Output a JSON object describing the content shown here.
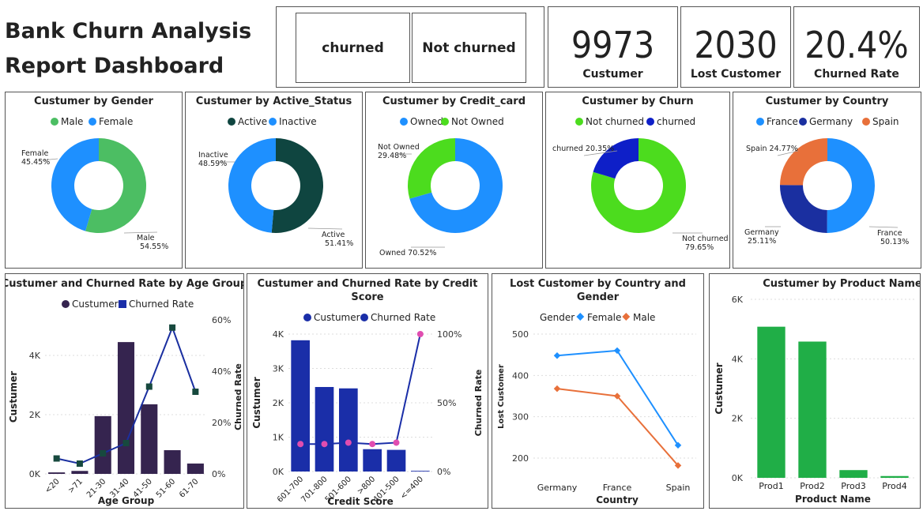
{
  "header": {
    "title_line1": "Bank Churn Analysis",
    "title_line2": "Report Dashboard"
  },
  "slicer": {
    "options": [
      "churned",
      "Not churned"
    ]
  },
  "kpis": [
    {
      "value": "9973",
      "label": "Custumer"
    },
    {
      "value": "2030",
      "label": "Lost Customer"
    },
    {
      "value": "20.4%",
      "label": "Churned Rate"
    }
  ],
  "colors": {
    "green": "#4CBE63",
    "blue": "#1E90FF",
    "darkteal": "#0F4540",
    "lime": "#4CDC1E",
    "navy": "#0E1FC8",
    "orange": "#E8703A",
    "darkblue": "#1A2FA0",
    "purple": "#35244F",
    "barblue": "#1A2EA8",
    "pink": "#E04DB0",
    "barGreen": "#20AE47"
  },
  "chart_data": [
    {
      "type": "pie",
      "title": "Custumer by Gender",
      "legend": [
        "Male",
        "Female"
      ],
      "slices": [
        {
          "name": "Male",
          "value": 54.55,
          "label": "Male",
          "pct": "54.55%",
          "color": "#4CBE63"
        },
        {
          "name": "Female",
          "value": 45.45,
          "label": "Female",
          "pct": "45.45%",
          "color": "#1E90FF"
        }
      ]
    },
    {
      "type": "pie",
      "title": "Custumer by Active_Status",
      "legend": [
        "Active",
        "Inactive"
      ],
      "slices": [
        {
          "name": "Active",
          "value": 51.41,
          "label": "Active",
          "pct": "51.41%",
          "color": "#0F4540"
        },
        {
          "name": "Inactive",
          "value": 48.59,
          "label": "Inactive",
          "pct": "48.59%",
          "color": "#1E90FF"
        }
      ]
    },
    {
      "type": "pie",
      "title": "Custumer by Credit_card",
      "legend": [
        "Owned",
        "Not Owned"
      ],
      "slices": [
        {
          "name": "Owned",
          "value": 70.52,
          "label": "Owned 70.52%",
          "pct": "",
          "color": "#1E90FF"
        },
        {
          "name": "Not Owned",
          "value": 29.48,
          "label": "Not Owned",
          "pct": "29.48%",
          "color": "#4CDC1E"
        }
      ]
    },
    {
      "type": "pie",
      "title": "Custumer by Churn",
      "legend": [
        "Not churned",
        "churned"
      ],
      "slices": [
        {
          "name": "Not churned",
          "value": 79.65,
          "label": "Not churned",
          "pct": "79.65%",
          "color": "#4CDC1E"
        },
        {
          "name": "churned",
          "value": 20.35,
          "label": "churned 20.35%",
          "pct": "",
          "color": "#0E1FC8"
        }
      ]
    },
    {
      "type": "pie",
      "title": "Custumer by Country",
      "legend": [
        "France",
        "Germany",
        "Spain"
      ],
      "slices": [
        {
          "name": "France",
          "value": 50.13,
          "label": "France",
          "pct": "50.13%",
          "color": "#1E90FF"
        },
        {
          "name": "Germany",
          "value": 25.11,
          "label": "Germany",
          "pct": "25.11%",
          "color": "#1A2FA0"
        },
        {
          "name": "Spain",
          "value": 24.77,
          "label": "Spain 24.77%",
          "pct": "",
          "color": "#E8703A"
        }
      ]
    },
    {
      "type": "bar",
      "title": "Custumer and Churned Rate by Age Group",
      "legend": [
        "Custumer",
        "Churned Rate"
      ],
      "categories": [
        "<20",
        ">71",
        "21-30",
        "31-40",
        "41-50",
        "51-60",
        "61-70"
      ],
      "series": [
        {
          "name": "Custumer",
          "values": [
            50,
            100,
            1950,
            4450,
            2350,
            800,
            350
          ]
        },
        {
          "name": "Churned Rate",
          "values": [
            6,
            4,
            8,
            12,
            34,
            57,
            32
          ]
        }
      ],
      "xlabel": "Age Group",
      "ylabel": "Custumer",
      "y2label": "Churned Rate",
      "yticks": [
        "0K",
        "2K",
        "4K"
      ],
      "y2ticks": [
        "0%",
        "20%",
        "40%",
        "60%"
      ],
      "ylim": [
        0,
        5200
      ],
      "y2lim": [
        0,
        60
      ]
    },
    {
      "type": "bar",
      "title_line1": "Custumer and Churned Rate by Credit",
      "title_line2": "Score",
      "legend": [
        "Custumer",
        "Churned Rate"
      ],
      "categories": [
        "601-700",
        "701-800",
        "501-600",
        ">800",
        "401-500",
        "<=400"
      ],
      "series": [
        {
          "name": "Custumer",
          "values": [
            3820,
            2460,
            2420,
            650,
            630,
            20
          ]
        },
        {
          "name": "Churned Rate",
          "values": [
            20,
            20,
            21,
            20,
            21,
            100
          ]
        }
      ],
      "xlabel": "Credit Score",
      "ylabel": "Custumer",
      "y2label": "Churned Rate",
      "yticks": [
        "0K",
        "1K",
        "2K",
        "3K",
        "4K"
      ],
      "y2ticks": [
        "0%",
        "50%",
        "100%"
      ],
      "ylim": [
        0,
        4000
      ],
      "y2lim": [
        0,
        100
      ]
    },
    {
      "type": "line",
      "title_line1": "Lost Customer by Country and",
      "title_line2": "Gender",
      "legend_title": "Gender",
      "legend": [
        "Female",
        "Male"
      ],
      "categories": [
        "Germany",
        "France",
        "Spain"
      ],
      "series": [
        {
          "name": "Female",
          "values": [
            448,
            460,
            231
          ]
        },
        {
          "name": "Male",
          "values": [
            368,
            350,
            182
          ]
        }
      ],
      "xlabel": "Country",
      "ylabel": "Lost Customer",
      "yticks": [
        "200",
        "300",
        "400",
        "500"
      ],
      "ylim": [
        200,
        500
      ]
    },
    {
      "type": "bar",
      "title": "Custumer by Product Name",
      "categories": [
        "Prod1",
        "Prod2",
        "Prod3",
        "Prod4"
      ],
      "series": [
        {
          "name": "Custumer",
          "values": [
            5080,
            4580,
            260,
            60
          ]
        }
      ],
      "xlabel": "Product Name",
      "ylabel": "Custumer",
      "yticks": [
        "0K",
        "2K",
        "4K",
        "6K"
      ],
      "ylim": [
        0,
        6000
      ]
    }
  ]
}
